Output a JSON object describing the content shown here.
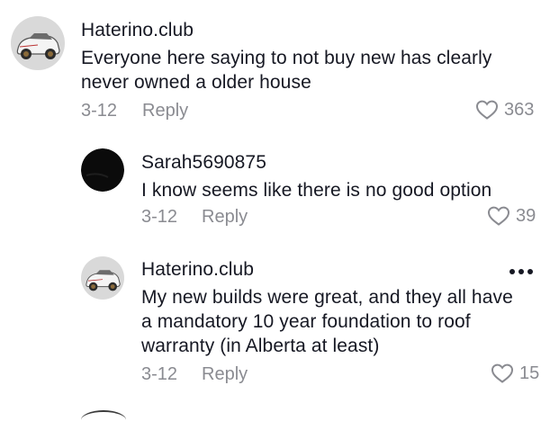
{
  "comments": [
    {
      "username": "Haterino.club",
      "text": "Everyone here saying to not buy new has clearly never owned a older house",
      "date": "3-12",
      "reply_label": "Reply",
      "likes": "363",
      "avatar_icon": "car-avatar-icon"
    },
    {
      "username": "Sarah5690875",
      "text": "I know seems like there is no good option",
      "date": "3-12",
      "reply_label": "Reply",
      "likes": "39",
      "avatar_icon": "dark-avatar-icon"
    },
    {
      "username": "Haterino.club",
      "text": "My new builds were great, and they all have a mandatory 10 year foundation to roof warranty (in Alberta at least)",
      "date": "3-12",
      "reply_label": "Reply",
      "likes": "15",
      "avatar_icon": "car-avatar-icon"
    }
  ],
  "colors": {
    "text": "#161823",
    "secondary": "#8a8b91",
    "background": "#ffffff"
  },
  "icons": [
    "heart-icon",
    "more-options-icon"
  ]
}
